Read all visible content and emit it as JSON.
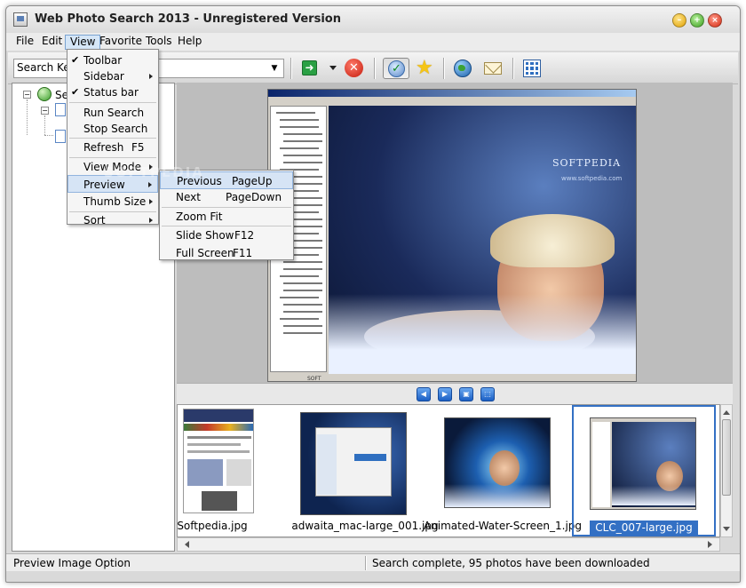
{
  "window": {
    "title": "Web Photo Search 2013 - Unregistered Version"
  },
  "menubar": {
    "items": [
      "File",
      "Edit",
      "View",
      "Favorite",
      "Tools",
      "Help"
    ]
  },
  "toolbar": {
    "search_label": "Search Ke",
    "search_value": ""
  },
  "sidebar": {
    "root_label": "Se"
  },
  "view_menu": {
    "items": [
      {
        "label": "Toolbar",
        "checked": true
      },
      {
        "label": "Sidebar",
        "submenu": true
      },
      {
        "label": "Status bar",
        "checked": true
      },
      {
        "label": "Run Search"
      },
      {
        "label": "Stop Search"
      },
      {
        "label": "Refresh",
        "shortcut": "F5"
      },
      {
        "label": "View Mode",
        "submenu": true
      },
      {
        "label": "Preview",
        "submenu": true,
        "highlighted": true
      },
      {
        "label": "Thumb Size",
        "submenu": true
      },
      {
        "label": "Sort",
        "submenu": true
      }
    ]
  },
  "preview_menu": {
    "items": [
      {
        "label": "Previous",
        "shortcut": "PageUp",
        "highlighted": true
      },
      {
        "label": "Next",
        "shortcut": "PageDown"
      },
      {
        "label": "Zoom Fit"
      },
      {
        "label": "Slide Show",
        "shortcut": "F12"
      },
      {
        "label": "Full Screen",
        "shortcut": "F11"
      }
    ]
  },
  "preview": {
    "brand_text": "SOFTPEDIA",
    "brand_sub": "www.softpedia.com",
    "watermark": "SOFTPEDIA",
    "inner_footer": "SOFT"
  },
  "thumbnails": [
    {
      "caption": "Softpedia.jpg",
      "selected": false
    },
    {
      "caption": "adwaita_mac-large_001.jpg",
      "selected": false
    },
    {
      "caption": "Animated-Water-Screen_1.jpg",
      "selected": false
    },
    {
      "caption": "CLC_007-large.jpg",
      "selected": true
    }
  ],
  "statusbar": {
    "left": "Preview Image Option",
    "right": "Search complete, 95 photos have been downloaded"
  },
  "icons": {
    "go": "arrow-right-icon",
    "stop": "stop-icon",
    "options": "check-icon",
    "favorite": "star-icon",
    "web": "globe-icon",
    "email": "mail-icon",
    "grid": "grid-icon"
  },
  "colors": {
    "selection": "#3370c4",
    "menu_highlight": "#d6e4f5",
    "toolbar_bg": "#e4e4e4"
  }
}
